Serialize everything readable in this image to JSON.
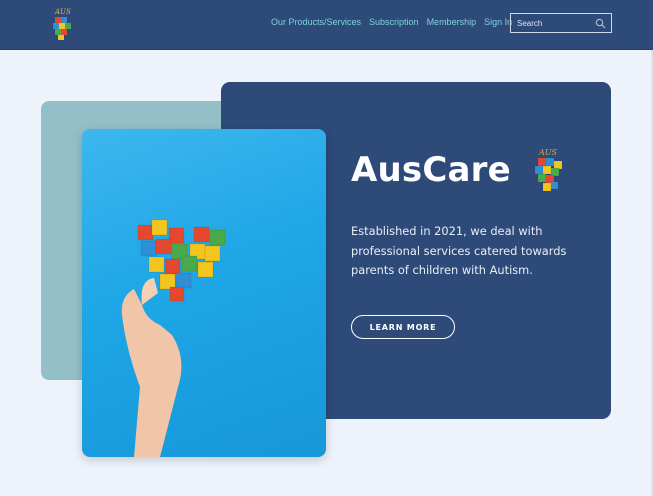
{
  "navbar": {
    "links": [
      "Our Products/Services",
      "Subscription",
      "Membership",
      "Sign In"
    ],
    "search": {
      "placeholder": "Search",
      "icon": "search-icon"
    }
  },
  "hero": {
    "title": "AusCare",
    "description": "Established in 2021, we deal with professional services catered towards parents of children with Autism.",
    "button_label": "LEARN MORE"
  },
  "logo_text": "AUS",
  "colors": {
    "navbar": "#2d4a79",
    "card": "#2d4a79",
    "teal_panel": "#93bfc8",
    "link": "#7fd3dd",
    "background": "#eef2fb"
  }
}
